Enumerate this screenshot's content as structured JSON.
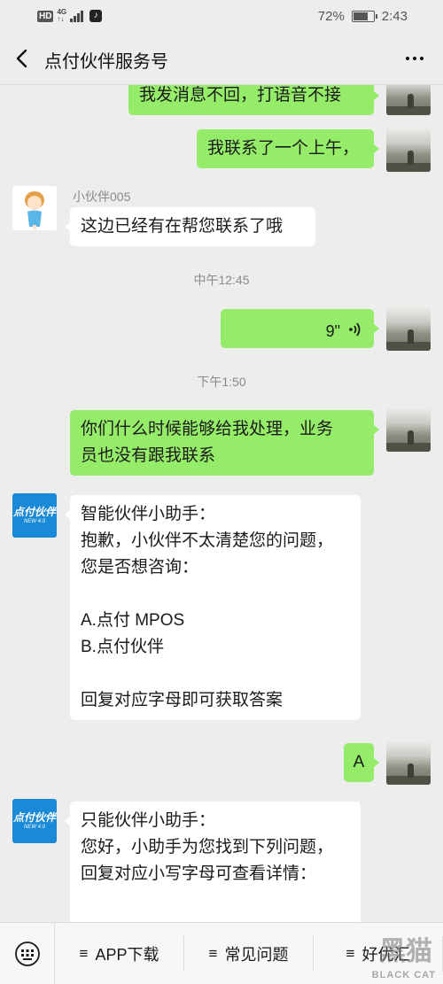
{
  "status_bar": {
    "hd": "HD",
    "network": "4G",
    "network_sub": "↑↓",
    "app_icon": "tiktok-icon",
    "battery": "72%",
    "time": "2:43"
  },
  "header": {
    "title": "点付伙伴服务号",
    "back_icon": "chevron-left-icon",
    "more_icon": "more-dots-icon"
  },
  "messages": [
    {
      "from": "me",
      "text": "我发消息不回，打语音不接"
    },
    {
      "from": "me",
      "text": "我联系了一个上午，"
    },
    {
      "from": "other",
      "sender": "小伙伴005",
      "text": "这边已经有在帮您联系了哦"
    },
    {
      "type": "time",
      "text": "中午12:45"
    },
    {
      "from": "me",
      "type": "voice",
      "duration": "9\""
    },
    {
      "type": "time",
      "text": "下午1:50"
    },
    {
      "from": "me",
      "lines": [
        "你们什么时候能够给我处理，业务",
        "员也没有跟我联系"
      ]
    },
    {
      "from": "other",
      "lines": [
        "智能伙伴小助手：",
        "抱歉，小伙伴不太清楚您的问题，",
        "您是否想咨询：",
        "",
        "A.点付 MPOS",
        "B.点付伙伴",
        "",
        "回复对应字母即可获取答案"
      ]
    },
    {
      "from": "me",
      "text": "A"
    },
    {
      "from": "other",
      "lines": [
        "只能伙伴小助手：",
        "您好，小助手为您找到下列问题，",
        "回复对应小写字母可查看详情：",
        ""
      ]
    }
  ],
  "logo": {
    "main": "点付伙伴",
    "sub": "NEW 4.0"
  },
  "bottom_menu": {
    "keyboard_icon": "keyboard-icon",
    "items": [
      {
        "icon": "≡",
        "label": "APP下载"
      },
      {
        "icon": "≡",
        "label": "常见问题"
      },
      {
        "icon": "≡",
        "label": "好优汇"
      }
    ]
  },
  "watermark": {
    "cn": "黑猫",
    "en": "BLACK CAT"
  },
  "colors": {
    "background": "#ededed",
    "my_bubble": "#95ec69",
    "other_bubble": "#ffffff",
    "logo_blue": "#1a8ad8"
  }
}
